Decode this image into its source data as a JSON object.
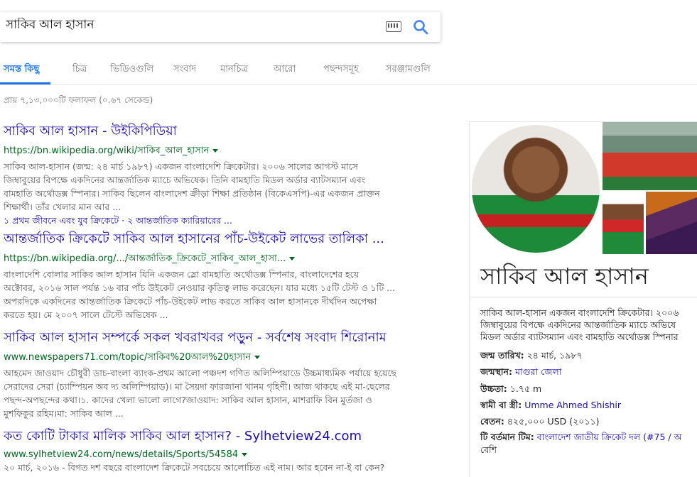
{
  "search": {
    "query": "সাকিব আল হাসান"
  },
  "tabs": [
    {
      "label": "সমস্ত কিছু"
    },
    {
      "label": "চিত্র"
    },
    {
      "label": "ভিডিওগুলি"
    },
    {
      "label": "সংবাদ"
    },
    {
      "label": "মানচিত্র"
    },
    {
      "label": "আরো"
    },
    {
      "label": "পছন্দসমূহ"
    },
    {
      "label": "সরঞ্জামগুলি"
    }
  ],
  "stats": "প্রায় ৭,১৩,০০০টি ফলাফল (০.৬৭ সেকেন্ড)",
  "results": [
    {
      "title": "সাকিব আল হাসান - উইকিপিডিয়া",
      "url": "https://bn.wikipedia.org/wiki/সাকিব_আল_হাসান",
      "snippet": [
        "সাকিব আল-হাসান (জন্ম: ২৪ মার্চ ১৯৮৭) একজন বাংলাদেশি ক্রিকেটার। ২০০৬ সালের আগস্ট মাসে",
        "জিম্বাবুয়ের বিপক্ষে একদিনের আন্তর্জাতিক ম্যাচে অভিষেক। তিনি বামহাতি মিডল অর্ডার ব্যাটসম্যান এবং",
        "বামহাতি অর্থোডক্স স্পিনার। সাকিব ছিলেন বাংলাদেশ ক্রীড়া শিক্ষা প্রতিষ্ঠান (বিকেএসপি)-এর একজন প্রাক্তন",
        "শিক্ষার্থী। তাঁর খেলার মান আর ..."
      ],
      "sublinks": "১ প্রথম জীবনে এবং যুব ক্রিকেটে · ২ আন্তর্জাতিক ক্যারিয়ারের ..."
    },
    {
      "title": "আন্তর্জাতিক ক্রিকেটে সাকিব আল হাসানের পাঁচ-উইকেট লাভের তালিকা ...",
      "url": "https://bn.wikipedia.org/.../আন্তর্জাতিক_ক্রিকেটে_সাকিব_আল_হাসা...",
      "snippet": [
        "বাংলাদেশি বোলার সাকিব আল হাসান যিনি একজন স্লো বামহাতি অর্থোডক্স স্পিনার, বাংলাদেশের হয়ে",
        "অক্টোবর, ২০১৬ সাল পর্যন্ত ১৬ বার পাঁচ উইকেট নেওয়ার কৃতিত্ব লাভ করেছেন। যার মধ্যে ১৫টি টেস্ট ও ১টি ...",
        "অপরদিকে একদিনের আন্তর্জাতিক ক্রিকেটে পাঁচ-উইকেট লাভ করতে সাকিব আল হাসানকে দীর্ঘদিন অপেক্ষা",
        "করতে হয়। মে ২০০৭ সালে টেস্টে অভিষেক ..."
      ],
      "sublinks": ""
    },
    {
      "title": "সাকিব আল হাসান সম্পর্কে সকল খবরাখবর পড়ুন - সর্বশেষ সংবাদ শিরোনাম",
      "url": "www.newspapers71.com/topic/সাকিব%20আল%20হাসান",
      "snippet": [
        "আহমেদ জাওয়াদ চৌধুরী ডাচ-বাংলা ব্যাংক-প্রথম আলো পঞ্চদশ গণিত অলিম্পিয়াডে উচ্চমাধ্যমিক পর্যায়ে হয়েছে",
        "সেরাদের সেরা (চ্যাম্পিয়ন অব দ্য অলিম্পিয়াড)। মা সৈয়দা ফারজানা খানম গৃহিণী। আজ থাকছে এই মা-ছেলের",
        "পছন্দ-অপছন্দের কথা।১. কাদের খেলা ভালো লাগে?জাওয়াদ: সাকিব আল হাসান, মাশরাফি বিন মুর্তজা ও",
        "মুশফিকুর রহিম।মা: সাকিব আল ..."
      ],
      "sublinks": ""
    },
    {
      "title": "কত কোটি টাকার মালিক সাকিব আল হাসান? - Sylhetview24.com",
      "url": "www.sylhetview24.com/news/details/Sports/54584",
      "snippet": [
        "২০ মার্চ, ২০১৬ - বিগত দশ বছরে বাংলাদেশ ক্রিকেটে সবচেয়ে আলোচিত এই নাম। আর হবেন না-ই বা কেন?"
      ],
      "sublinks": ""
    }
  ],
  "knowledge_panel": {
    "title": "সাকিব আল হাসান",
    "description": [
      "সাকিব আল-হাসান একজন বাংলাদেশি ক্রিকেটার। ২০০৬",
      "জিম্বাবুয়ের বিপক্ষে একদিনের আন্তর্জাতিক ম্যাচে অভিষে",
      "মিডল অর্ডার ব্যাটসম্যান এবং বামহাতি অর্থোডক্স স্পিনার"
    ],
    "facts": [
      {
        "key": "জন্ম তারিখ:",
        "value": "২৪ মার্চ, ১৯৮৭",
        "link": false
      },
      {
        "key": "জন্মস্থান:",
        "value": "মাগুরা জেলা",
        "link": true
      },
      {
        "key": "উচ্চতা:",
        "value": "১.৭৫ m",
        "link": false
      },
      {
        "key": "স্বামী বা স্ত্রী:",
        "value": "Umme Ahmed Shishir",
        "link": true
      },
      {
        "key": "বেতন:",
        "value": "৪২৫,০০০ USD (২০১১)",
        "link": false
      },
      {
        "key": "টি বর্তমান টিম:",
        "value": "বাংলাদেশ জাতীয় ক্রিকেট দল (#75 / অ",
        "link": true
      }
    ],
    "more": "বেশি"
  },
  "colors": {
    "accent": "#1a73e8",
    "link": "#1a0dab",
    "url": "#006621"
  }
}
